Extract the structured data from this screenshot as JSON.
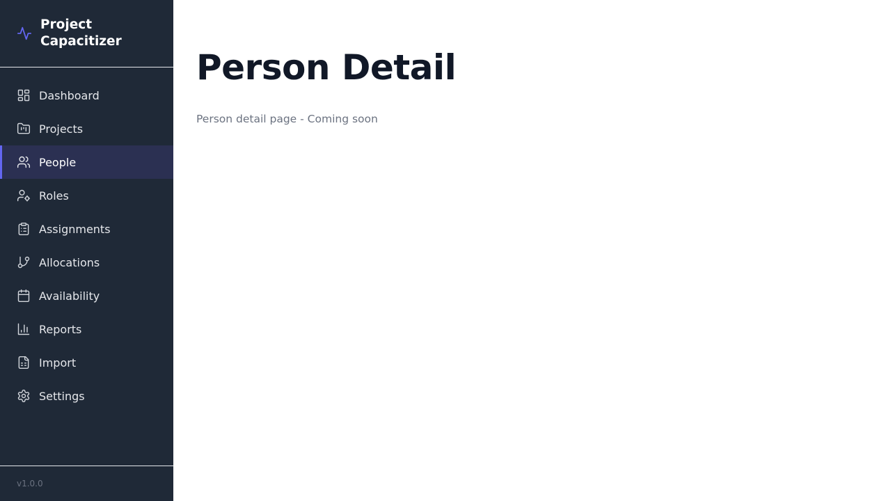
{
  "app": {
    "title": "Project\nCapacitizer",
    "icon": "activity-icon",
    "accent_color": "#6366f1",
    "version": "v1.0.0"
  },
  "sidebar": {
    "items": [
      {
        "label": "Dashboard",
        "icon": "dashboard-icon",
        "active": false
      },
      {
        "label": "Projects",
        "icon": "folder-icon",
        "active": false
      },
      {
        "label": "People",
        "icon": "users-icon",
        "active": true
      },
      {
        "label": "Roles",
        "icon": "user-cog-icon",
        "active": false
      },
      {
        "label": "Assignments",
        "icon": "clipboard-icon",
        "active": false
      },
      {
        "label": "Allocations",
        "icon": "git-branch-icon",
        "active": false
      },
      {
        "label": "Availability",
        "icon": "calendar-icon",
        "active": false
      },
      {
        "label": "Reports",
        "icon": "bar-chart-icon",
        "active": false
      },
      {
        "label": "Import",
        "icon": "file-spreadsheet-icon",
        "active": false
      },
      {
        "label": "Settings",
        "icon": "gear-icon",
        "active": false
      }
    ]
  },
  "main": {
    "title": "Person Detail",
    "subtitle": "Person detail page - Coming soon"
  }
}
